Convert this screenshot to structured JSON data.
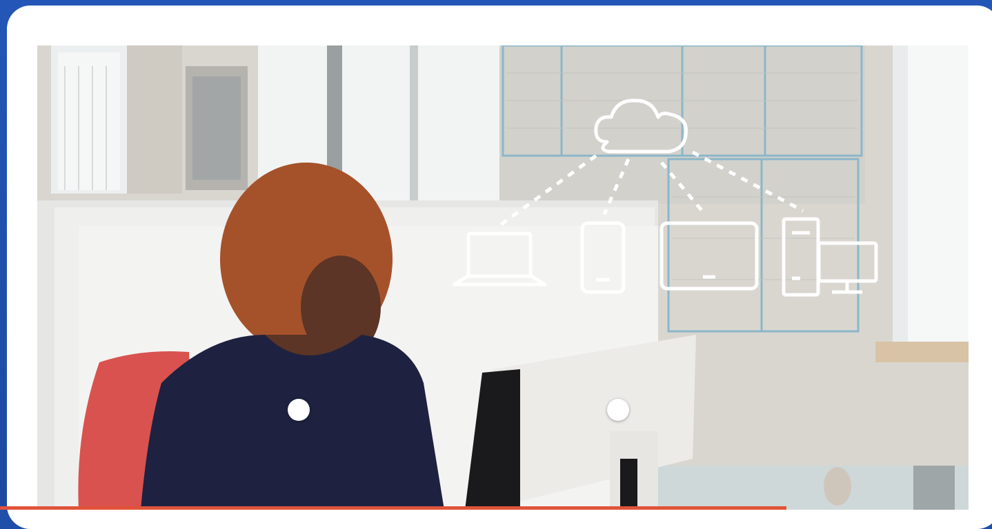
{
  "scene": {
    "description_alt": "",
    "hotspots": [
      {
        "id": "hotspot-person"
      },
      {
        "id": "hotspot-monitor"
      }
    ],
    "overlay_icons": [
      "cloud-icon",
      "laptop-icon",
      "phone-icon",
      "tablet-icon",
      "desktop-computer-icon"
    ]
  },
  "colors": {
    "frame_blue": "#1f4fa8",
    "card_white": "#ffffff",
    "accent_orange": "#e0533a",
    "overlay_line": "#ffffff"
  }
}
